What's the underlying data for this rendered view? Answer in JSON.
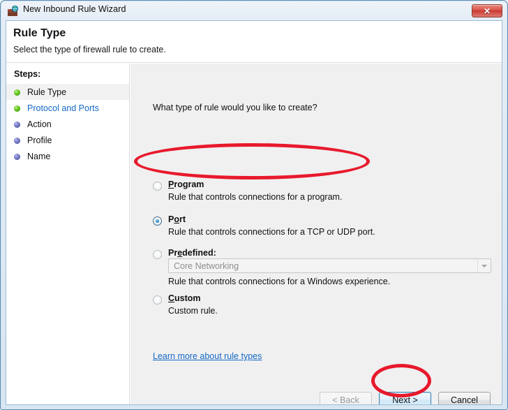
{
  "window": {
    "title": "New Inbound Rule Wizard",
    "icon": "firewall-brick-globe-icon",
    "close_label": "✕"
  },
  "header": {
    "title": "Rule Type",
    "subtitle": "Select the type of firewall rule to create."
  },
  "sidebar": {
    "label": "Steps:",
    "items": [
      {
        "label": "Rule Type",
        "state": "current",
        "bullet": "green"
      },
      {
        "label": "Protocol and Ports",
        "state": "link",
        "bullet": "green"
      },
      {
        "label": "Action",
        "state": "pending",
        "bullet": "blue"
      },
      {
        "label": "Profile",
        "state": "pending",
        "bullet": "blue"
      },
      {
        "label": "Name",
        "state": "pending",
        "bullet": "blue"
      }
    ]
  },
  "main": {
    "question": "What type of rule would you like to create?",
    "options": [
      {
        "accel_before": "",
        "accel": "P",
        "accel_after": "rogram",
        "title": "Program",
        "description": "Rule that controls connections for a program.",
        "selected": false
      },
      {
        "accel_before": "P",
        "accel": "o",
        "accel_after": "rt",
        "title": "Port",
        "description": "Rule that controls connections for a TCP or UDP port.",
        "selected": true
      },
      {
        "accel_before": "Pr",
        "accel": "e",
        "accel_after": "defined:",
        "title": "Predefined:",
        "description": "Rule that controls connections for a Windows experience.",
        "selected": false
      },
      {
        "accel_before": "",
        "accel": "C",
        "accel_after": "ustom",
        "title": "Custom",
        "description": "Custom rule.",
        "selected": false
      }
    ],
    "predefined_dropdown": {
      "value": "Core Networking",
      "enabled": false,
      "arrow_icon": "chevron-down-icon"
    },
    "learn_more_link": "Learn more about rule types"
  },
  "buttons": {
    "back": "< Back",
    "next": "Next >",
    "cancel": "Cancel"
  },
  "annotations": {
    "accent_color": "#e8192c",
    "highlighted": [
      "Port option",
      "Next button"
    ]
  }
}
